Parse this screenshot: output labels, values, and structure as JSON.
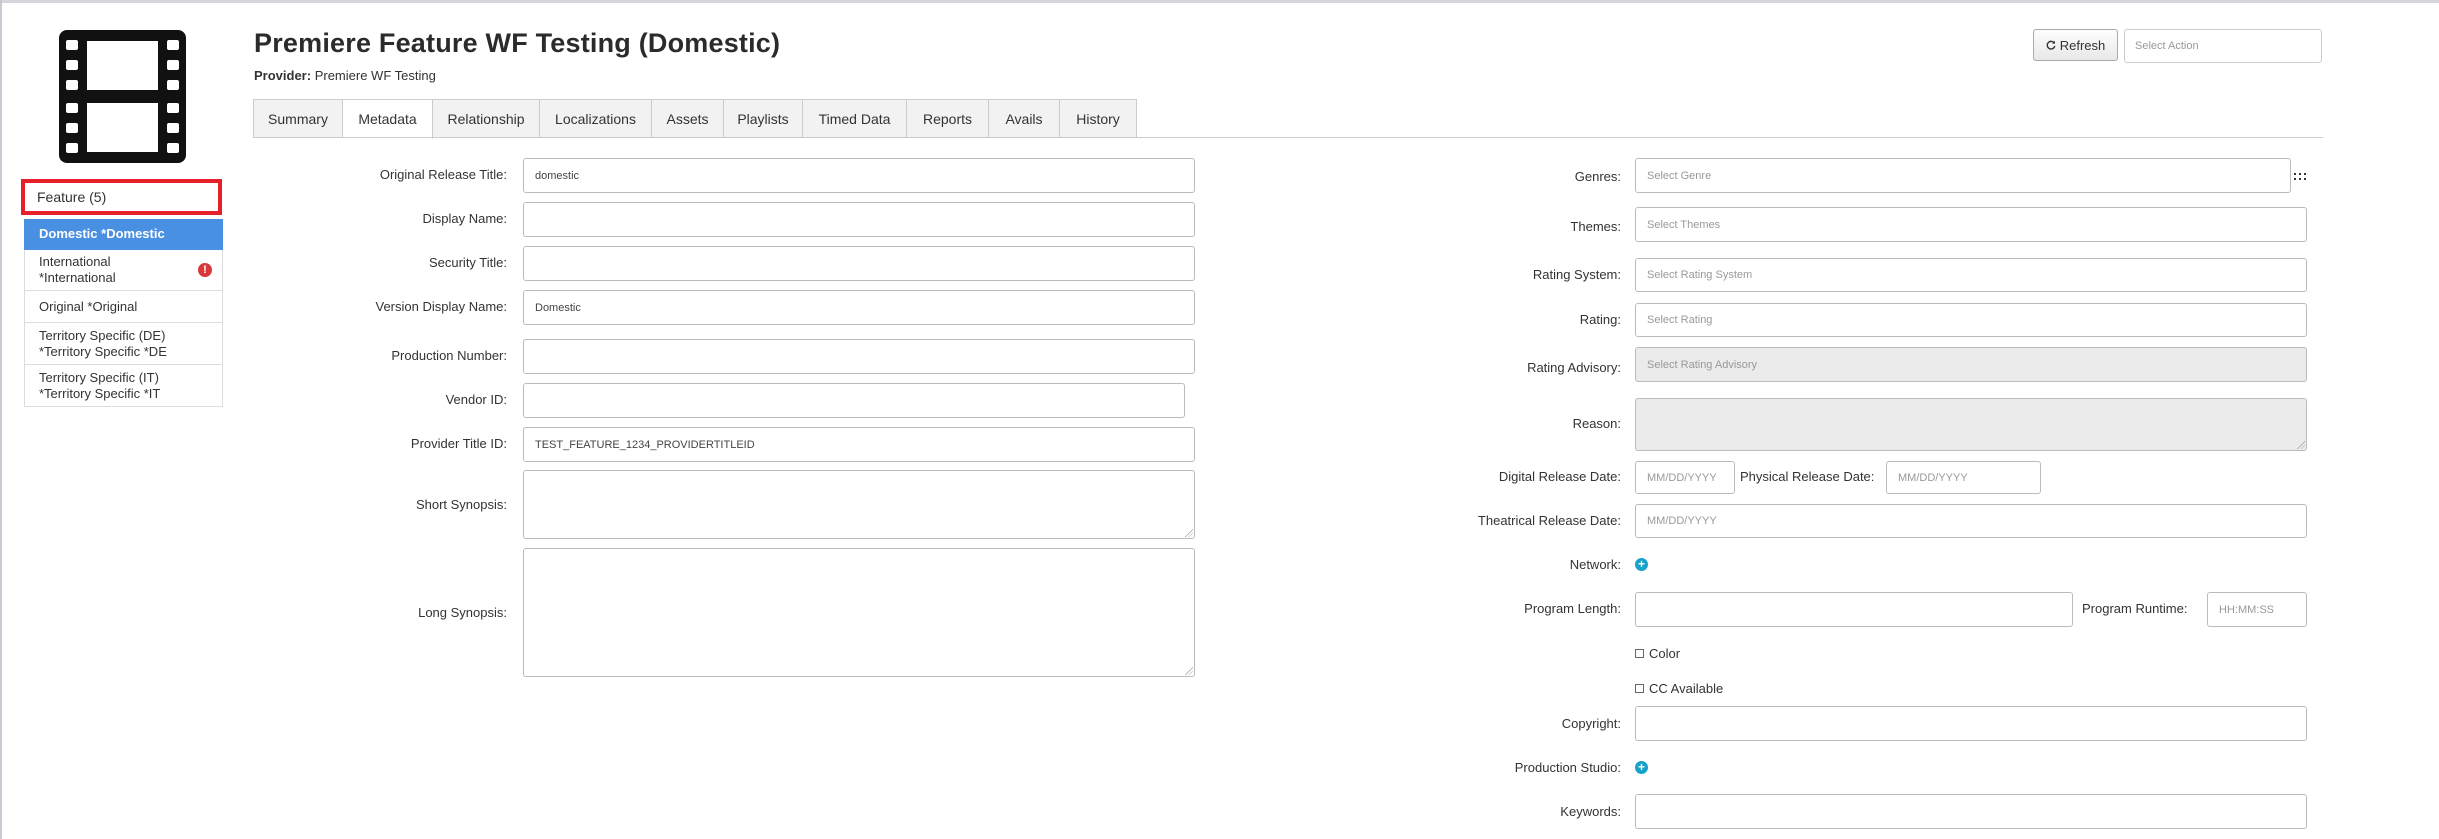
{
  "header": {
    "title": "Premiere Feature WF Testing (Domestic)",
    "provider_label": "Provider:",
    "provider_value": "Premiere WF Testing",
    "refresh_label": "Refresh",
    "select_action_placeholder": "Select Action"
  },
  "sidebar": {
    "feature_header": "Feature (5)",
    "items": [
      {
        "line1": "Domestic *Domestic",
        "line2": "",
        "active": true,
        "error": false
      },
      {
        "line1": "International",
        "line2": "*International",
        "active": false,
        "error": true
      },
      {
        "line1": "Original *Original",
        "line2": "",
        "active": false,
        "error": false
      },
      {
        "line1": "Territory Specific (DE)",
        "line2": "*Territory Specific *DE",
        "active": false,
        "error": false
      },
      {
        "line1": "Territory Specific (IT)",
        "line2": "*Territory Specific *IT",
        "active": false,
        "error": false
      }
    ],
    "error_glyph": "!"
  },
  "tabs": [
    "Summary",
    "Metadata",
    "Relationship",
    "Localizations",
    "Assets",
    "Playlists",
    "Timed Data",
    "Reports",
    "Avails",
    "History"
  ],
  "active_tab": "Metadata",
  "left_form": {
    "original_release_title": {
      "label": "Original Release Title:",
      "value": "domestic"
    },
    "display_name": {
      "label": "Display Name:",
      "value": ""
    },
    "security_title": {
      "label": "Security Title:",
      "value": ""
    },
    "version_display_name": {
      "label": "Version Display Name:",
      "value": "Domestic"
    },
    "production_number": {
      "label": "Production Number:",
      "value": ""
    },
    "vendor_id": {
      "label": "Vendor ID:",
      "value": ""
    },
    "provider_title_id": {
      "label": "Provider Title ID:",
      "value": "TEST_FEATURE_1234_PROVIDERTITLEID"
    },
    "short_synopsis": {
      "label": "Short Synopsis:",
      "value": ""
    },
    "long_synopsis": {
      "label": "Long Synopsis:",
      "value": ""
    }
  },
  "right_form": {
    "genres": {
      "label": "Genres:",
      "placeholder": "Select Genre"
    },
    "themes": {
      "label": "Themes:",
      "placeholder": "Select Themes"
    },
    "rating_system": {
      "label": "Rating System:",
      "placeholder": "Select Rating System"
    },
    "rating": {
      "label": "Rating:",
      "placeholder": "Select Rating"
    },
    "rating_advisory": {
      "label": "Rating Advisory:",
      "placeholder": "Select Rating Advisory"
    },
    "reason": {
      "label": "Reason:",
      "value": ""
    },
    "digital_release_date": {
      "label": "Digital Release Date:",
      "placeholder": "MM/DD/YYYY"
    },
    "physical_release_date": {
      "label": "Physical Release Date:",
      "placeholder": "MM/DD/YYYY"
    },
    "theatrical_release_date": {
      "label": "Theatrical Release Date:",
      "placeholder": "MM/DD/YYYY"
    },
    "network": {
      "label": "Network:"
    },
    "program_length": {
      "label": "Program Length:",
      "value": ""
    },
    "program_runtime": {
      "label": "Program Runtime:",
      "placeholder": "HH:MM:SS"
    },
    "color": {
      "label": "Color",
      "checked": false
    },
    "cc_available": {
      "label": "CC Available",
      "checked": false
    },
    "copyright": {
      "label": "Copyright:",
      "value": ""
    },
    "production_studio": {
      "label": "Production Studio:"
    },
    "keywords": {
      "label": "Keywords:",
      "value": ""
    }
  },
  "icons": {
    "refresh": "refresh-icon",
    "plus": "+",
    "film": "film-icon",
    "grid": "grid-dots-icon"
  },
  "colors": {
    "active_nav": "#4a90e2",
    "highlight_border": "#e5202a",
    "plus_icon": "#17a2c8",
    "error": "#d9383a"
  }
}
